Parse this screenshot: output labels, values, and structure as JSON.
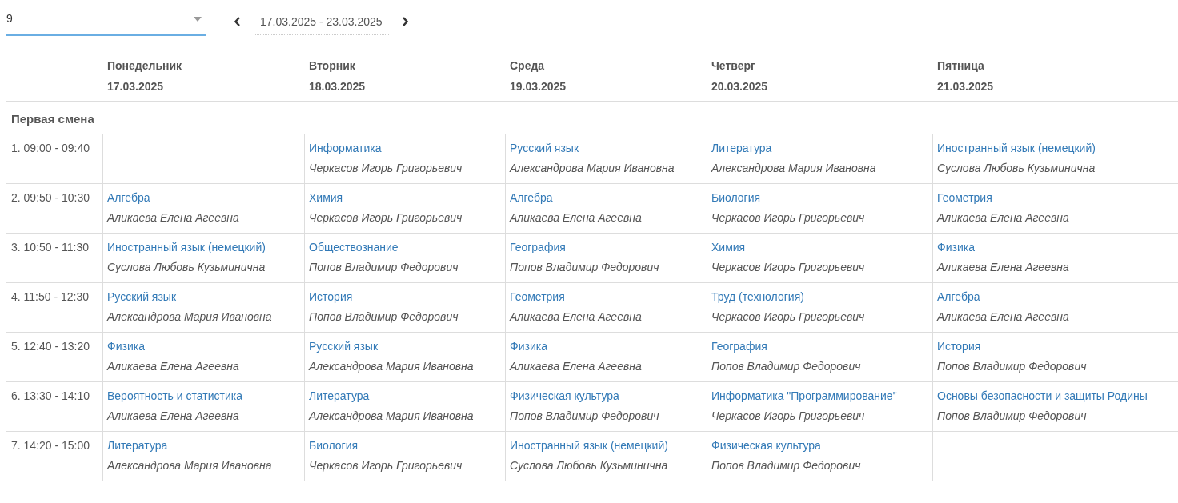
{
  "class_select": {
    "value": "9"
  },
  "week": {
    "range": "17.03.2025 - 23.03.2025"
  },
  "days": [
    {
      "name": "Понедельник",
      "date": "17.03.2025"
    },
    {
      "name": "Вторник",
      "date": "18.03.2025"
    },
    {
      "name": "Среда",
      "date": "19.03.2025"
    },
    {
      "name": "Четверг",
      "date": "20.03.2025"
    },
    {
      "name": "Пятница",
      "date": "21.03.2025"
    }
  ],
  "shift": "Первая смена",
  "rows": [
    {
      "time": "1. 09:00 - 09:40",
      "lessons": [
        {
          "kind": "empty"
        },
        {
          "kind": "lesson",
          "subject": "Информатика",
          "teacher": "Черкасов Игорь Григорьевич"
        },
        {
          "kind": "lesson",
          "subject": "Русский язык",
          "teacher": "Александрова Мария Ивановна"
        },
        {
          "kind": "lesson",
          "subject": "Литература",
          "teacher": "Александрова Мария Ивановна"
        },
        {
          "kind": "lesson",
          "subject": "Иностранный язык (немецкий)",
          "teacher": "Суслова Любовь Кузьминична"
        }
      ]
    },
    {
      "time": "2. 09:50 - 10:30",
      "lessons": [
        {
          "kind": "lesson",
          "subject": "Алгебра",
          "teacher": "Аликаева Елена Агеевна"
        },
        {
          "kind": "lesson",
          "subject": "Химия",
          "teacher": "Черкасов Игорь Григорьевич"
        },
        {
          "kind": "lesson",
          "subject": "Алгебра",
          "teacher": "Аликаева Елена Агеевна"
        },
        {
          "kind": "lesson",
          "subject": "Биология",
          "teacher": "Черкасов Игорь Григорьевич"
        },
        {
          "kind": "lesson",
          "subject": "Геометрия",
          "teacher": "Аликаева Елена Агеевна"
        }
      ]
    },
    {
      "time": "3. 10:50 - 11:30",
      "lessons": [
        {
          "kind": "lesson",
          "subject": "Иностранный язык (немецкий)",
          "teacher": "Суслова Любовь Кузьминична"
        },
        {
          "kind": "lesson",
          "subject": "Обществознание",
          "teacher": "Попов Владимир Федорович"
        },
        {
          "kind": "lesson",
          "subject": "География",
          "teacher": "Попов Владимир Федорович"
        },
        {
          "kind": "lesson",
          "subject": "Химия",
          "teacher": "Черкасов Игорь Григорьевич"
        },
        {
          "kind": "lesson",
          "subject": "Физика",
          "teacher": "Аликаева Елена Агеевна"
        }
      ]
    },
    {
      "time": "4. 11:50 - 12:30",
      "lessons": [
        {
          "kind": "lesson",
          "subject": "Русский язык",
          "teacher": "Александрова Мария Ивановна"
        },
        {
          "kind": "lesson",
          "subject": "История",
          "teacher": "Попов Владимир Федорович"
        },
        {
          "kind": "lesson",
          "subject": "Геометрия",
          "teacher": "Аликаева Елена Агеевна"
        },
        {
          "kind": "lesson",
          "subject": "Труд (технология)",
          "teacher": "Черкасов Игорь Григорьевич"
        },
        {
          "kind": "lesson",
          "subject": "Алгебра",
          "teacher": "Аликаева Елена Агеевна"
        }
      ]
    },
    {
      "time": "5. 12:40 - 13:20",
      "lessons": [
        {
          "kind": "lesson",
          "subject": "Физика",
          "teacher": "Аликаева Елена Агеевна"
        },
        {
          "kind": "lesson",
          "subject": "Русский язык",
          "teacher": "Александрова Мария Ивановна"
        },
        {
          "kind": "lesson",
          "subject": "Физика",
          "teacher": "Аликаева Елена Агеевна"
        },
        {
          "kind": "lesson",
          "subject": "География",
          "teacher": "Попов Владимир Федорович"
        },
        {
          "kind": "lesson",
          "subject": "История",
          "teacher": "Попов Владимир Федорович"
        }
      ]
    },
    {
      "time": "6. 13:30 - 14:10",
      "lessons": [
        {
          "kind": "lesson",
          "subject": "Вероятность и статистика",
          "teacher": "Аликаева Елена Агеевна"
        },
        {
          "kind": "lesson",
          "subject": "Литература",
          "teacher": "Александрова Мария Ивановна"
        },
        {
          "kind": "lesson",
          "subject": "Физическая культура",
          "teacher": "Попов Владимир Федорович"
        },
        {
          "kind": "lesson",
          "subject": "Информатика \"Программирование\"",
          "teacher": "Черкасов Игорь Григорьевич"
        },
        {
          "kind": "lesson",
          "subject": "Основы безопасности и защиты Родины",
          "teacher": "Попов Владимир Федорович"
        }
      ]
    },
    {
      "time": "7. 14:20 - 15:00",
      "lessons": [
        {
          "kind": "lesson",
          "subject": "Литература",
          "teacher": "Александрова Мария Ивановна"
        },
        {
          "kind": "lesson",
          "subject": "Биология",
          "teacher": "Черкасов Игорь Григорьевич"
        },
        {
          "kind": "lesson",
          "subject": "Иностранный язык (немецкий)",
          "teacher": "Суслова Любовь Кузьминична"
        },
        {
          "kind": "lesson",
          "subject": "Физическая культура",
          "teacher": "Попов Владимир Федорович"
        },
        {
          "kind": "empty"
        }
      ]
    }
  ]
}
